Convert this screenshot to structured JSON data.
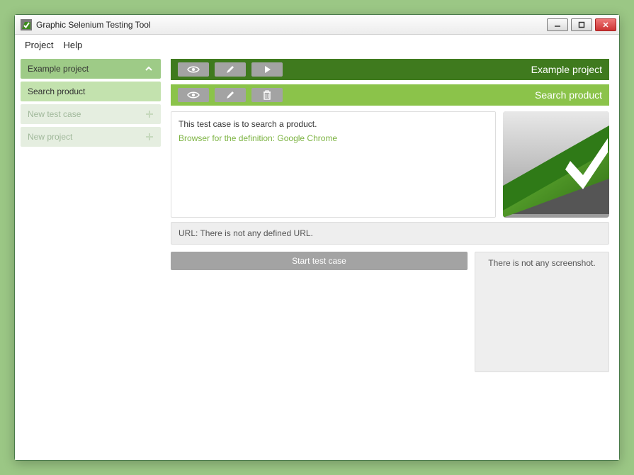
{
  "window": {
    "title": "Graphic Selenium Testing Tool"
  },
  "menubar": {
    "project": "Project",
    "help": "Help"
  },
  "sidebar": {
    "project": {
      "label": "Example project"
    },
    "testcase": {
      "label": "Search product"
    },
    "newtest": {
      "label": "New test case"
    },
    "newproj": {
      "label": "New project"
    }
  },
  "header_project": {
    "title": "Example project"
  },
  "header_testcase": {
    "title": "Search product"
  },
  "description": {
    "text": "This test case is to search a product.",
    "browser_line": "Browser for the definition: Google Chrome"
  },
  "url_box": {
    "text": "URL: There is not any defined URL."
  },
  "start_button": {
    "label": "Start test case"
  },
  "screenshot_box": {
    "text": "There is not any screenshot."
  }
}
